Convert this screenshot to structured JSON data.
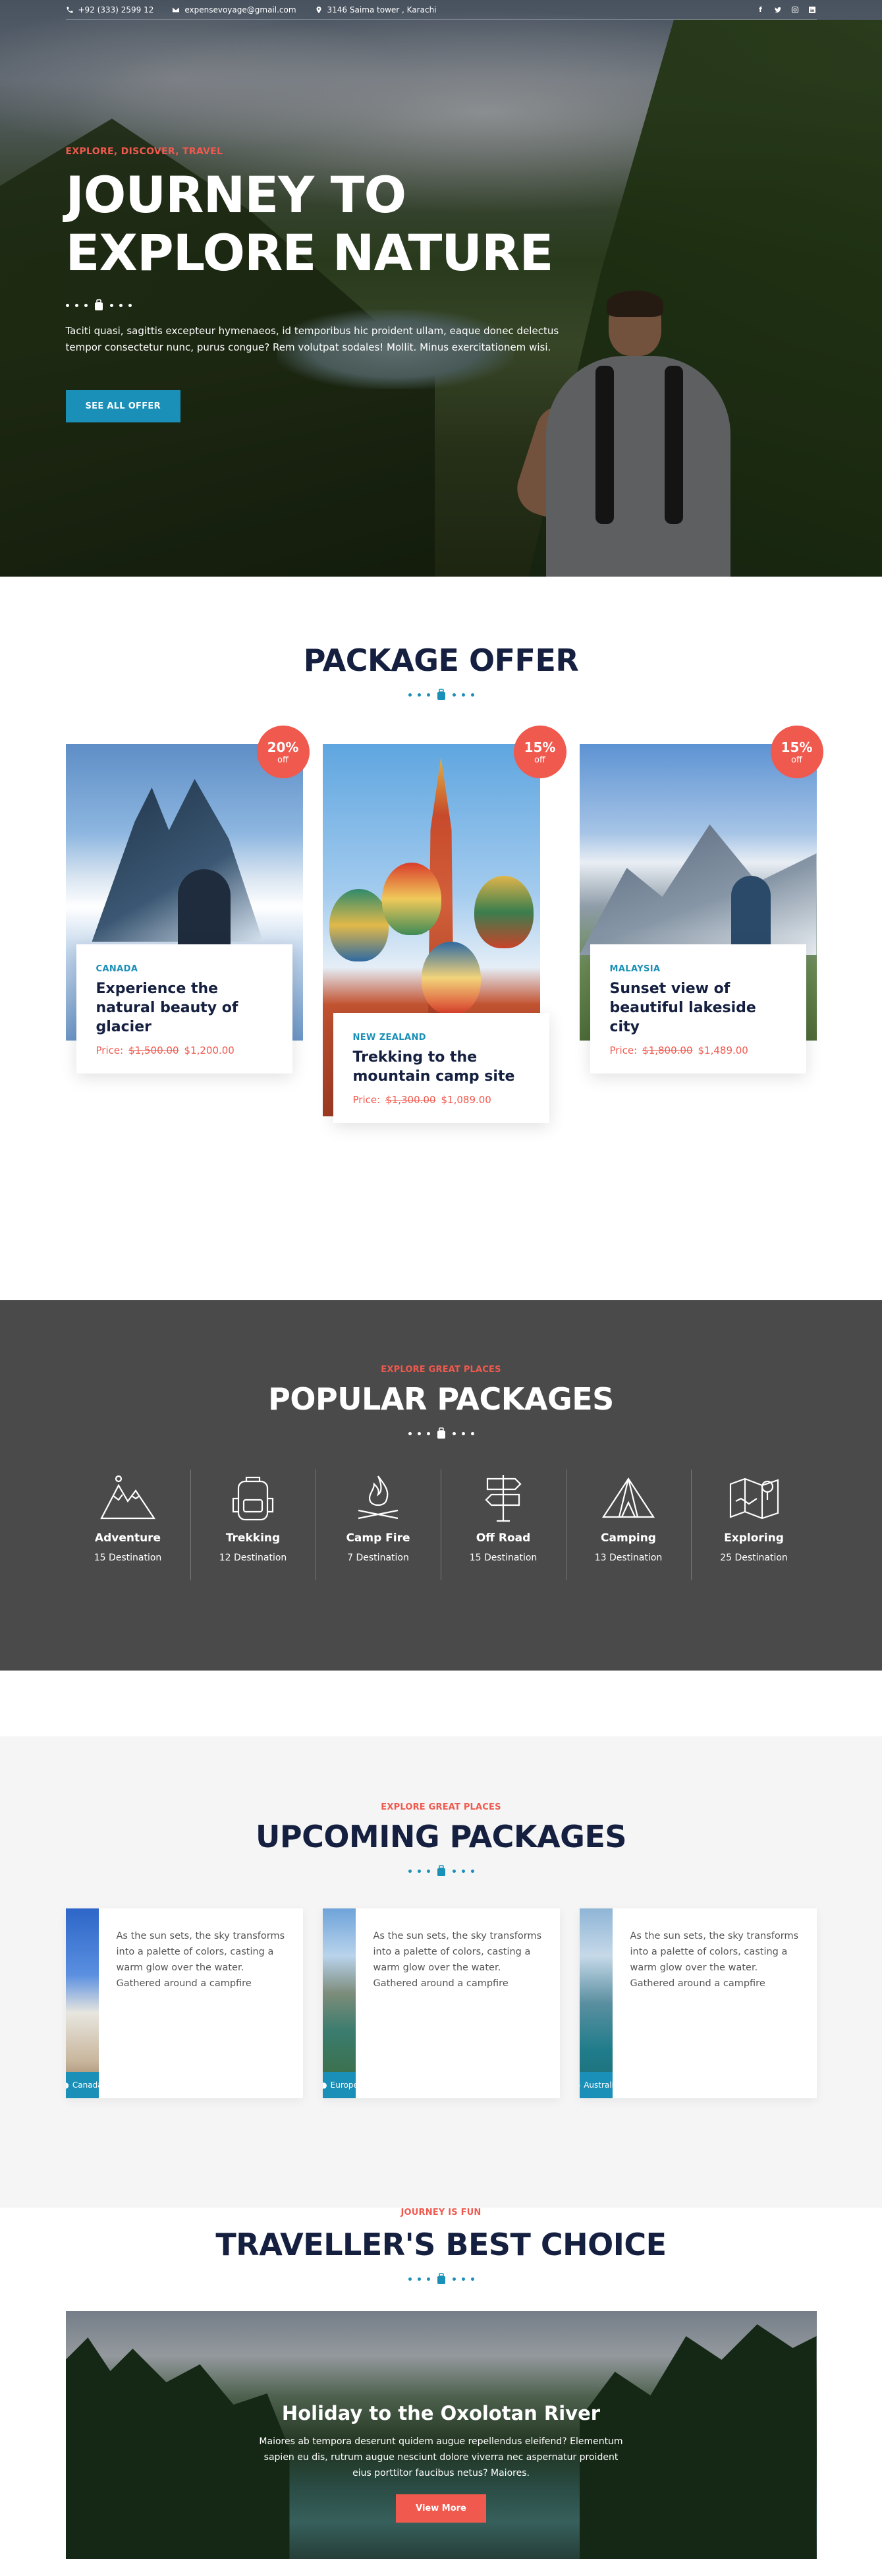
{
  "topbar": {
    "phone": "+92 (333) 2599 12",
    "email": "expensevoyage@gmail.com",
    "address": "3146 Saima tower , Karachi",
    "social": [
      "facebook-icon",
      "twitter-icon",
      "instagram-icon",
      "linkedin-icon"
    ]
  },
  "hero": {
    "eyebrow": "EXPLORE, DISCOVER, TRAVEL",
    "title_line1": "JOURNEY TO",
    "title_line2": "EXPLORE NATURE",
    "text": "Taciti quasi, sagittis excepteur hymenaeos, id temporibus hic proident ullam, eaque donec delectus tempor consectetur nunc, purus congue? Rem volutpat sodales! Mollit. Minus exercitationem wisi.",
    "button": "SEE ALL OFFER"
  },
  "offers": {
    "title": "PACKAGE OFFER",
    "cards": [
      {
        "badge_pct": "20%",
        "badge_off": "off",
        "country": "CANADA",
        "title": "Experience the natural beauty of glacier",
        "price_label": "Price:",
        "old_price": "$1,500.00",
        "new_price": "$1,200.00"
      },
      {
        "badge_pct": "15%",
        "badge_off": "off",
        "country": "NEW ZEALAND",
        "title": "Trekking to the mountain camp site",
        "price_label": "Price:",
        "old_price": "$1,300.00",
        "new_price": "$1,089.00"
      },
      {
        "badge_pct": "15%",
        "badge_off": "off",
        "country": "MALAYSIA",
        "title": "Sunset view of beautiful lakeside city",
        "price_label": "Price:",
        "old_price": "$1,800.00",
        "new_price": "$1,489.00"
      }
    ]
  },
  "popular": {
    "eyebrow": "EXPLORE GREAT PLACES",
    "title": "POPULAR PACKAGES",
    "items": [
      {
        "icon": "mountains-icon",
        "name": "Adventure",
        "dest": "15 Destination"
      },
      {
        "icon": "backpack-icon",
        "name": "Trekking",
        "dest": "12 Destination"
      },
      {
        "icon": "campfire-icon",
        "name": "Camp Fire",
        "dest": "7 Destination"
      },
      {
        "icon": "signpost-icon",
        "name": "Off Road",
        "dest": "15 Destination"
      },
      {
        "icon": "tent-icon",
        "name": "Camping",
        "dest": "13 Destination"
      },
      {
        "icon": "map-icon",
        "name": "Exploring",
        "dest": "25 Destination"
      }
    ]
  },
  "upcoming": {
    "eyebrow": "EXPLORE GREAT PLACES",
    "title": "UPCOMING PACKAGES",
    "cards": [
      {
        "location": "Canada",
        "text": "As the sun sets, the sky transforms into a palette of colors, casting a warm glow over the water. Gathered around a campfire"
      },
      {
        "location": "Europe",
        "text": "As the sun sets, the sky transforms into a palette of colors, casting a warm glow over the water. Gathered around a campfire"
      },
      {
        "location": "Australia",
        "text": "As the sun sets, the sky transforms into a palette of colors, casting a warm glow over the water. Gathered around a campfire"
      }
    ]
  },
  "best": {
    "eyebrow": "JOURNEY IS FUN",
    "title": "TRAVELLER'S BEST CHOICE",
    "banner_title": "Holiday to the Oxolotan River",
    "banner_text": "Maiores ab tempora deserunt quidem augue repellendus eleifend? Elementum sapien eu dis, rutrum augue nesciunt dolore viverra nec aspernatur proident eius porttitor faucibus netus? Maiores.",
    "banner_button": "View More"
  },
  "colors": {
    "accent_red": "#f0594e",
    "accent_blue": "#1a8fb8",
    "navy": "#152040",
    "dark_section": "#4a4a4a"
  }
}
